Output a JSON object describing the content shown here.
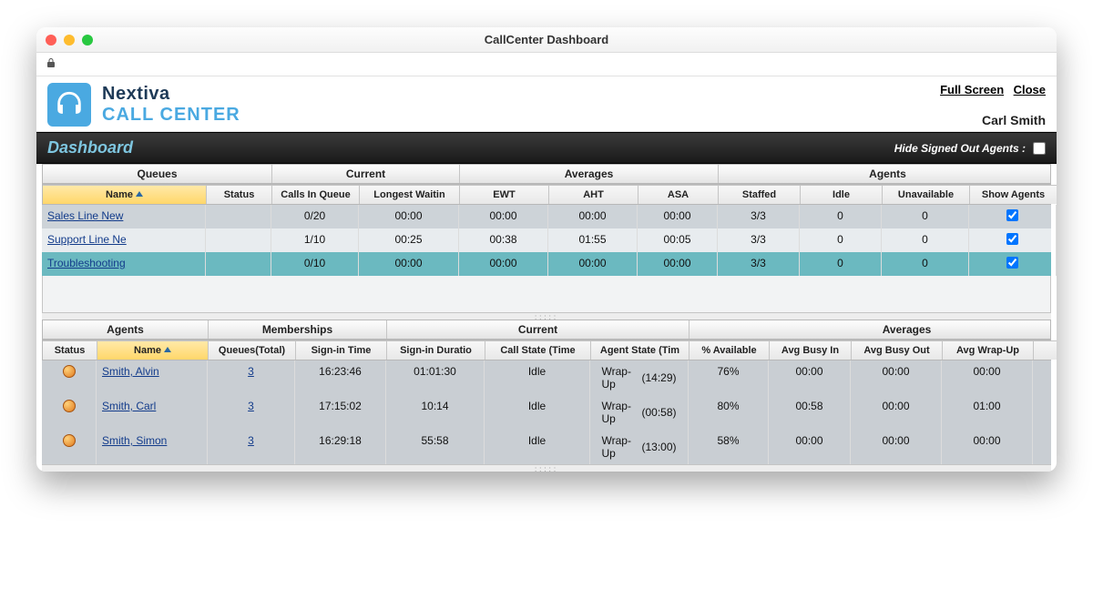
{
  "window": {
    "title": "CallCenter Dashboard"
  },
  "brand": {
    "line1": "Nextiva",
    "line2": "CALL CENTER"
  },
  "top_links": {
    "fullscreen": "Full Screen",
    "close": "Close",
    "user": "Carl Smith"
  },
  "dash_header": {
    "title": "Dashboard",
    "hide_label": "Hide Signed Out Agents :"
  },
  "queues": {
    "group_labels": {
      "queues": "Queues",
      "current": "Current",
      "averages": "Averages",
      "agents": "Agents"
    },
    "headers": {
      "name": "Name",
      "status": "Status",
      "calls_in_queue": "Calls In Queue",
      "longest_wait": "Longest Waitin",
      "ewt": "EWT",
      "aht": "AHT",
      "asa": "ASA",
      "staffed": "Staffed",
      "idle": "Idle",
      "unavailable": "Unavailable",
      "show_agents": "Show Agents"
    },
    "rows": [
      {
        "name": "Sales Line New",
        "status": "",
        "calls": "0/20",
        "longest": "00:00",
        "ewt": "00:00",
        "aht": "00:00",
        "asa": "00:00",
        "staffed": "3/3",
        "idle": "0",
        "unavail": "0",
        "show": true
      },
      {
        "name": "Support Line Ne",
        "status": "",
        "calls": "1/10",
        "longest": "00:25",
        "ewt": "00:38",
        "aht": "01:55",
        "asa": "00:05",
        "staffed": "3/3",
        "idle": "0",
        "unavail": "0",
        "show": true
      },
      {
        "name": "Troubleshooting",
        "status": "",
        "calls": "0/10",
        "longest": "00:00",
        "ewt": "00:00",
        "aht": "00:00",
        "asa": "00:00",
        "staffed": "3/3",
        "idle": "0",
        "unavail": "0",
        "show": true
      }
    ]
  },
  "agents": {
    "group_labels": {
      "agents": "Agents",
      "memberships": "Memberships",
      "current": "Current",
      "averages": "Averages"
    },
    "headers": {
      "status": "Status",
      "name": "Name",
      "queues_total": "Queues(Total)",
      "signin_time": "Sign-in Time",
      "signin_dur": "Sign-in Duratio",
      "call_state": "Call State (Time",
      "agent_state": "Agent State (Tim",
      "pct_avail": "% Available",
      "busy_in": "Avg Busy In",
      "busy_out": "Avg Busy Out",
      "wrap_up": "Avg Wrap-Up"
    },
    "rows": [
      {
        "name": "Smith, Alvin",
        "queues": "3",
        "signin": "16:23:46",
        "dur": "01:01:30",
        "call": "Idle",
        "astate": "Wrap-Up",
        "atime": "(14:29)",
        "pct": "76%",
        "bin": "00:00",
        "bout": "00:00",
        "wrap": "00:00"
      },
      {
        "name": "Smith, Carl",
        "queues": "3",
        "signin": "17:15:02",
        "dur": "10:14",
        "call": "Idle",
        "astate": "Wrap-Up",
        "atime": "(00:58)",
        "pct": "80%",
        "bin": "00:58",
        "bout": "00:00",
        "wrap": "01:00"
      },
      {
        "name": "Smith, Simon",
        "queues": "3",
        "signin": "16:29:18",
        "dur": "55:58",
        "call": "Idle",
        "astate": "Wrap-Up",
        "atime": "(13:00)",
        "pct": "58%",
        "bin": "00:00",
        "bout": "00:00",
        "wrap": "00:00"
      }
    ]
  }
}
